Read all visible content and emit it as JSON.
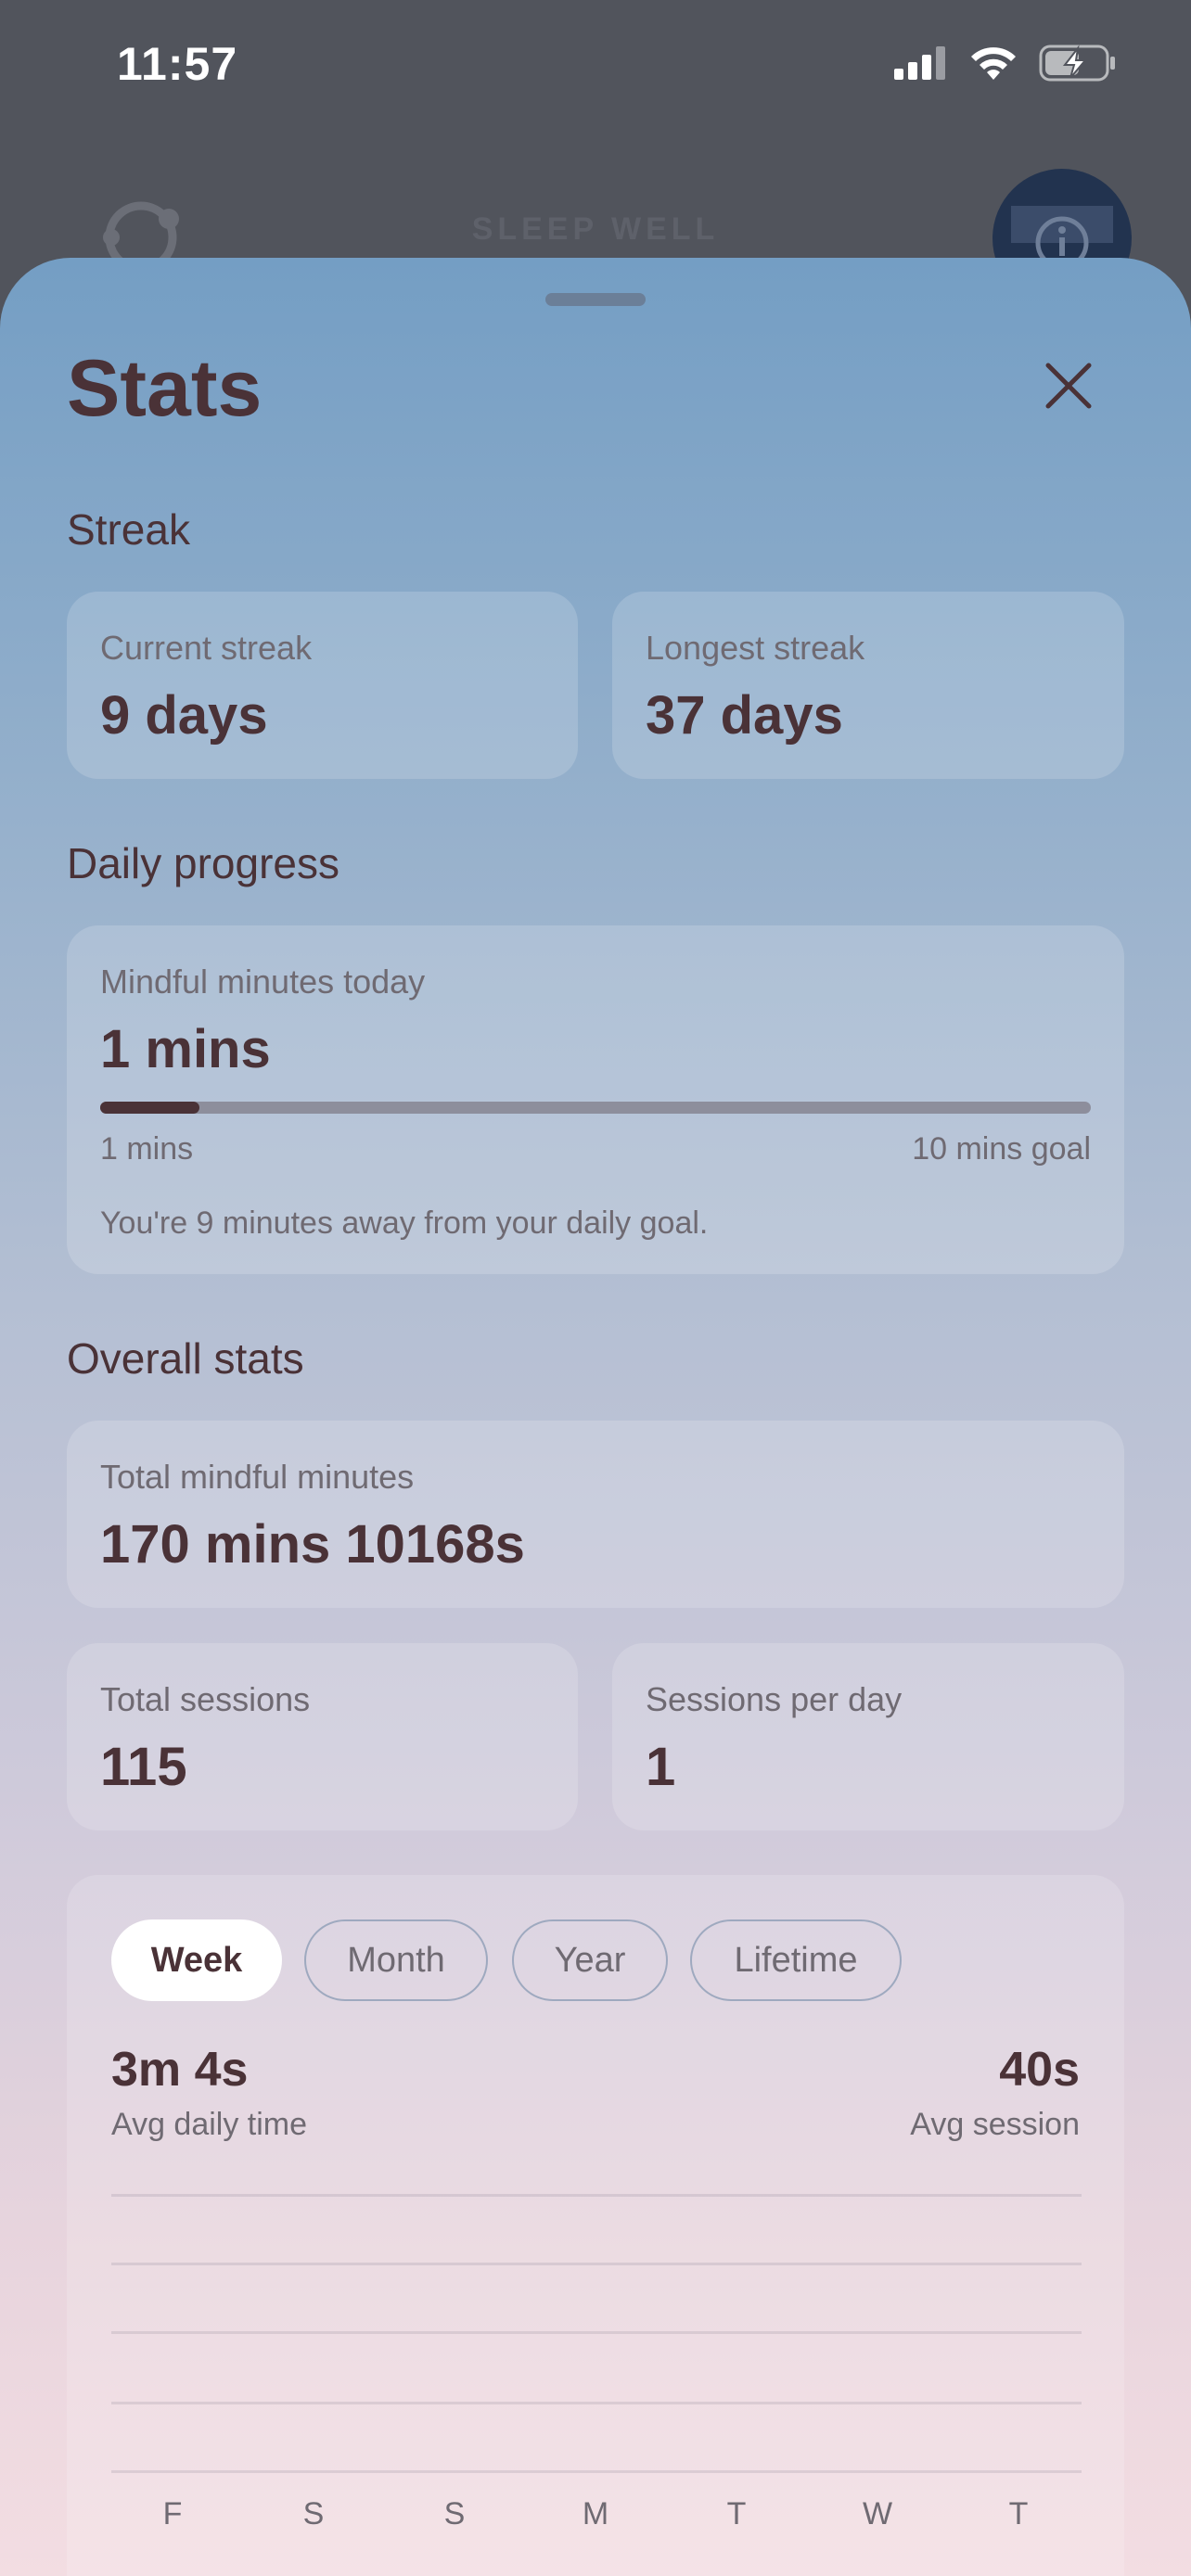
{
  "status_bar": {
    "time": "11:57"
  },
  "app": {
    "title": "SLEEP WELL"
  },
  "sheet": {
    "title": "Stats",
    "streak": {
      "heading": "Streak",
      "current_label": "Current streak",
      "current_value": "9 days",
      "longest_label": "Longest streak",
      "longest_value": "37 days"
    },
    "daily": {
      "heading": "Daily progress",
      "label": "Mindful minutes today",
      "value": "1 mins",
      "progress_fraction": 0.1,
      "min_label": "1 mins",
      "goal_label": "10 mins goal",
      "message": "You're 9 minutes away from your daily goal."
    },
    "overall": {
      "heading": "Overall stats",
      "total_minutes_label": "Total mindful minutes",
      "total_minutes_value": "170 mins 10168s",
      "total_sessions_label": "Total sessions",
      "total_sessions_value": "115",
      "sessions_per_day_label": "Sessions per day",
      "sessions_per_day_value": "1"
    },
    "period": {
      "tabs": [
        "Week",
        "Month",
        "Year",
        "Lifetime"
      ],
      "selected": "Week",
      "avg_daily_value": "3m 4s",
      "avg_daily_label": "Avg daily time",
      "avg_session_value": "40s",
      "avg_session_label": "Avg session",
      "days": [
        "F",
        "S",
        "S",
        "M",
        "T",
        "W",
        "T"
      ]
    }
  },
  "colors": {
    "text": "#4a3237",
    "muted": "#6f6a72",
    "track": "#8d8e9c"
  }
}
